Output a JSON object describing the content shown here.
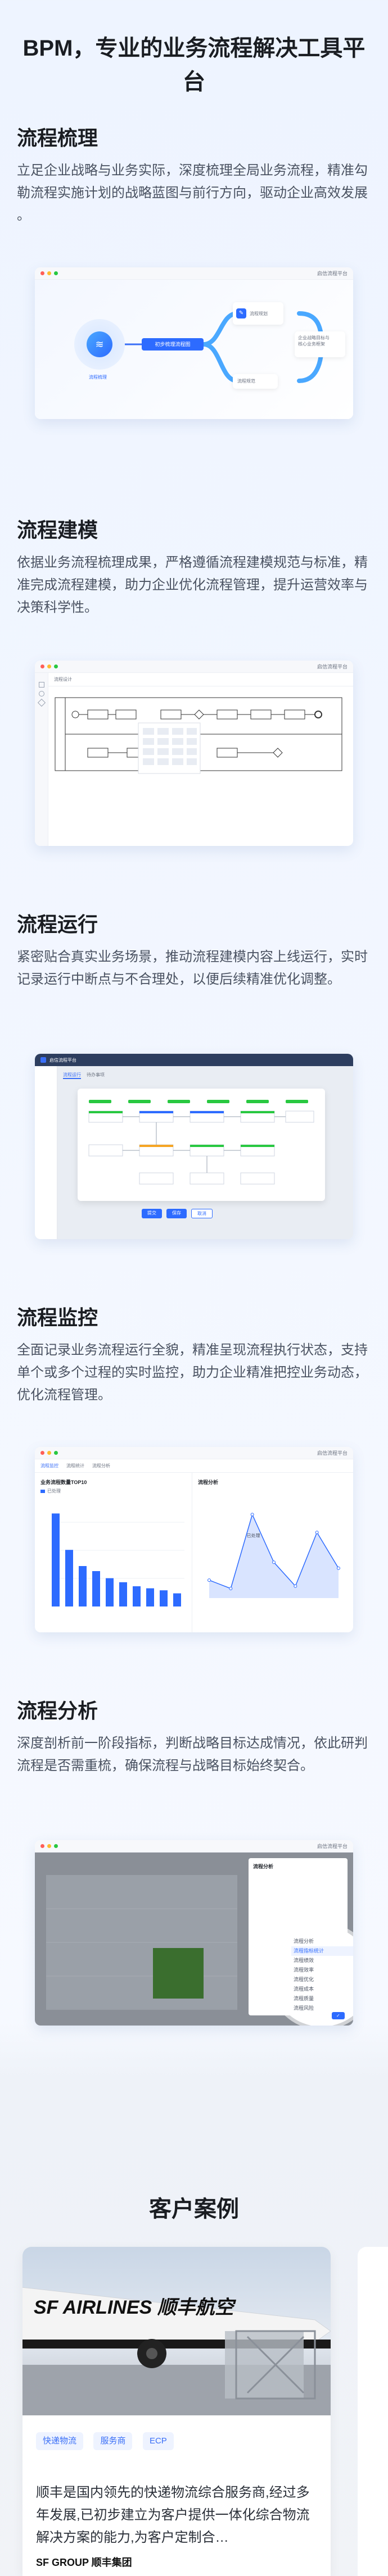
{
  "page": {
    "title": "BPM，专业的业务流程解决工具平台"
  },
  "sections": [
    {
      "title": "流程梳理",
      "desc": "立足企业战略与业务实际，深度梳理全局业务流程，精准勾勒流程实施计划的战略蓝图与前行方向，驱动企业高效发展 。"
    },
    {
      "title": "流程建模",
      "desc": "依据业务流程梳理成果，严格遵循流程建模规范与标准，精准完成流程建模，助力企业优化流程管理，提升运营效率与决策科学性。"
    },
    {
      "title": "流程运行",
      "desc": "紧密贴合真实业务场景，推动流程建模内容上线运行，实时记录运行中断点与不合理处，以便后续精准优化调整。"
    },
    {
      "title": "流程监控",
      "desc": "全面记录业务流程运行全貌，精准呈现流程执行状态，支持单个或多个过程的实时监控，助力企业精准把控业务动态，优化流程管理。"
    },
    {
      "title": "流程分析",
      "desc": "深度剖析前一阶段指标，判断战略目标达成情况，依此研判流程是否需重梳，确保流程与战略目标始终契合。"
    }
  ],
  "screens": {
    "app_title": "启信流程平台",
    "s1": {
      "center_node": "流程梳理",
      "mid_node": "初步梳理流程图",
      "right_top": "流程规划",
      "right_mid": "企业战略目标与\n核心业务框架",
      "right_bottom": "流程规范"
    },
    "s2": {
      "toolbar": "流程设计"
    },
    "s3": {
      "brand": "启信流程平台",
      "tab1": "流程运行",
      "tab2": "待办事项",
      "btn1": "提交",
      "btn2": "保存",
      "btn3": "取消"
    },
    "s4": {
      "tab1": "流程监控",
      "tab2": "流程统计",
      "tab3": "流程分析",
      "left_title": "业务流程数量TOP10",
      "right_title": "流程分析",
      "legend": "已处理",
      "point_label": "已处理"
    },
    "s5": {
      "panel_title": "流程分析",
      "panel_items": [
        "流程分析",
        "流程指标统计",
        "流程绩效",
        "流程效率",
        "流程优化",
        "流程成本",
        "流程质量",
        "流程风险"
      ]
    }
  },
  "chart_bars": [
    92,
    56,
    40,
    35,
    28,
    24,
    20,
    18,
    16,
    13
  ],
  "chart_line": [
    15,
    8,
    70,
    30,
    10,
    55,
    25
  ],
  "cases": {
    "title": "客户案例",
    "company_logo_text": "SF AIRLINES 顺丰航空",
    "tags": [
      "快递物流",
      "服务商",
      "ECP"
    ],
    "desc": "顺丰是国内领先的快递物流综合服务商,经过多年发展,已初步建立为客户提供一体化综合物流解决方案的能力,为客户定制合…",
    "footer_logo": "SF GROUP 顺丰集团"
  },
  "colors": {
    "primary": "#3a6ff7",
    "accent": "#2d6bff"
  }
}
